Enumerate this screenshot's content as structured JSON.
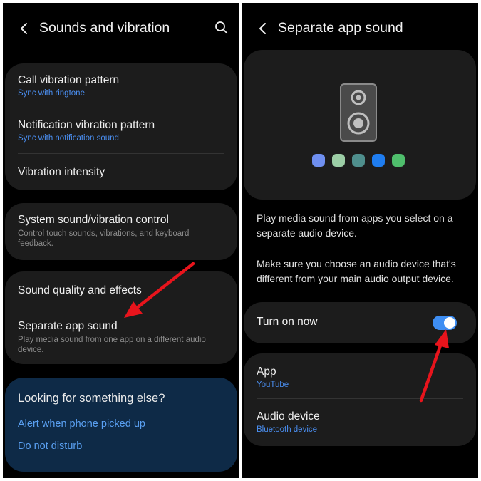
{
  "left_screen": {
    "title": "Sounds and vibration",
    "vibration_card": [
      {
        "title": "Call vibration pattern",
        "subtitle": "Sync with ringtone"
      },
      {
        "title": "Notification vibration pattern",
        "subtitle": "Sync with notification sound"
      },
      {
        "title": "Vibration intensity"
      }
    ],
    "system_card": {
      "title": "System sound/vibration control",
      "description": "Control touch sounds, vibrations, and keyboard feedback."
    },
    "quality_card": [
      {
        "title": "Sound quality and effects"
      },
      {
        "title": "Separate app sound",
        "description": "Play media sound from one app on a different audio device."
      }
    ],
    "suggestions": {
      "title": "Looking for something else?",
      "links": [
        "Alert when phone picked up",
        "Do not disturb"
      ]
    }
  },
  "right_screen": {
    "title": "Separate app sound",
    "dot_colors": [
      "#6f8ff0",
      "#9ccea6",
      "#4f8f8d",
      "#1f7df0",
      "#4fbe6c"
    ],
    "description_1": "Play media sound from apps you select on a separate audio device.",
    "description_2": "Make sure you choose an audio device that's different from your main audio output device.",
    "toggle": {
      "label": "Turn on now",
      "on": true
    },
    "settings": [
      {
        "title": "App",
        "value": "YouTube"
      },
      {
        "title": "Audio device",
        "value": "Bluetooth device"
      }
    ]
  },
  "colors": {
    "accent": "#3e8ef3",
    "link": "#4a8ef0",
    "annotation_arrow": "#e8141c",
    "card": "#1c1c1c",
    "suggestion_card": "#0e2a47"
  }
}
